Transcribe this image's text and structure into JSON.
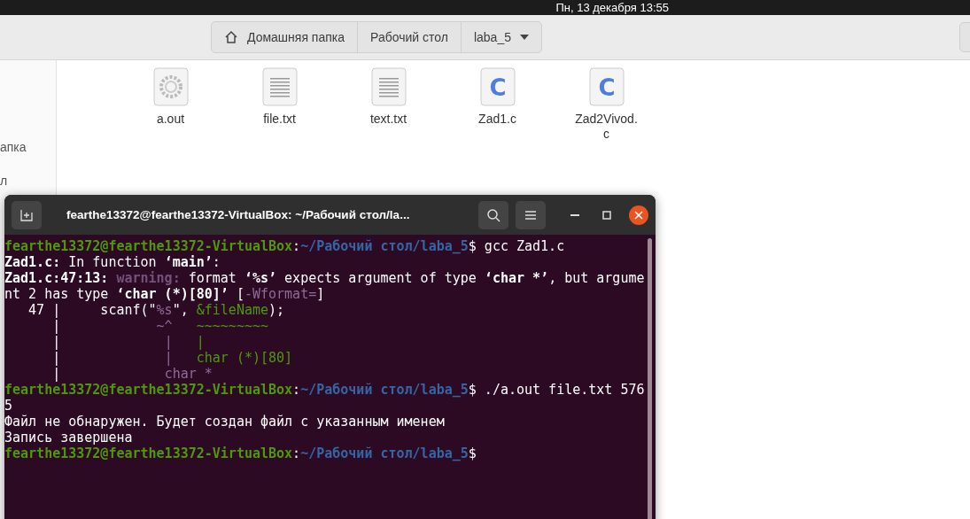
{
  "top_bar": {
    "clock": "Пн, 13 декабря  13:55"
  },
  "path_bar": {
    "items": [
      {
        "label": "Домашняя папка",
        "kind": "home"
      },
      {
        "label": "Рабочий стол",
        "kind": "plain"
      },
      {
        "label": "laba_5",
        "kind": "dropdown"
      }
    ]
  },
  "sidebar": {
    "items": [
      "апка",
      "л"
    ]
  },
  "files": [
    {
      "name": "a.out",
      "kind": "binary"
    },
    {
      "name": "file.txt",
      "kind": "text"
    },
    {
      "name": "text.txt",
      "kind": "text"
    },
    {
      "name": "Zad1.c",
      "kind": "c",
      "glyph": "C"
    },
    {
      "name": "Zad2Vivod.\nc",
      "kind": "c",
      "glyph": "C"
    }
  ],
  "terminal": {
    "title": "fearthe13372@fearthe13372-VirtualBox: ~/Рабочий стол/la...",
    "lines": [
      [
        {
          "text": "fearthe13372@fearthe13372-VirtualBox",
          "kind": "user"
        },
        {
          "text": ":",
          "kind": "plain"
        },
        {
          "text": "~/Рабочий стол/laba_5",
          "kind": "path"
        },
        {
          "text": "$ gcc Zad1.c",
          "kind": "plain"
        }
      ],
      [
        {
          "text": "Zad1.c:",
          "kind": "bold"
        },
        {
          "text": " In function ",
          "kind": "plain"
        },
        {
          "text": "‘main’",
          "kind": "bold"
        },
        {
          "text": ":",
          "kind": "plain"
        }
      ],
      [
        {
          "text": "Zad1.c:47:13:",
          "kind": "bold"
        },
        {
          "text": " warning:",
          "kind": "warn"
        },
        {
          "text": " format ",
          "kind": "plain"
        },
        {
          "text": "‘%s’",
          "kind": "bold"
        },
        {
          "text": " expects argument of type ",
          "kind": "plain"
        },
        {
          "text": "‘char *’",
          "kind": "bold"
        },
        {
          "text": ", but argume",
          "kind": "plain"
        }
      ],
      [
        {
          "text": "nt 2 has type ",
          "kind": "plain"
        },
        {
          "text": "‘char (*)[80]’",
          "kind": "bold"
        },
        {
          "text": " [",
          "kind": "plain"
        },
        {
          "text": "-Wformat=",
          "kind": "magenta"
        },
        {
          "text": "]",
          "kind": "plain"
        }
      ],
      [
        {
          "text": "   47 |     scanf(\"",
          "kind": "plain"
        },
        {
          "text": "%s",
          "kind": "magenta"
        },
        {
          "text": "\", ",
          "kind": "plain"
        },
        {
          "text": "&fileName",
          "kind": "green"
        },
        {
          "text": ");",
          "kind": "plain"
        }
      ],
      [
        {
          "text": "      |            ",
          "kind": "plain"
        },
        {
          "text": "~^",
          "kind": "magenta"
        },
        {
          "text": "   ~~~~~~~~~",
          "kind": "green"
        }
      ],
      [
        {
          "text": "      |             ",
          "kind": "plain"
        },
        {
          "text": "|",
          "kind": "magenta"
        },
        {
          "text": "   |",
          "kind": "green"
        }
      ],
      [
        {
          "text": "      |             ",
          "kind": "plain"
        },
        {
          "text": "|",
          "kind": "magenta"
        },
        {
          "text": "   char (*)[80]",
          "kind": "green"
        }
      ],
      [
        {
          "text": "      |             ",
          "kind": "plain"
        },
        {
          "text": "char *",
          "kind": "magenta"
        }
      ],
      [
        {
          "text": "fearthe13372@fearthe13372-VirtualBox",
          "kind": "user"
        },
        {
          "text": ":",
          "kind": "plain"
        },
        {
          "text": "~/Рабочий стол/laba_5",
          "kind": "path"
        },
        {
          "text": "$ ./a.out file.txt 576",
          "kind": "plain"
        }
      ],
      [
        {
          "text": "5",
          "kind": "plain"
        }
      ],
      [
        {
          "text": "Файл не обнаружен. Будет создан файл с указанным именем",
          "kind": "plain"
        }
      ],
      [
        {
          "text": "Запись завершена",
          "kind": "plain"
        }
      ],
      [
        {
          "text": "fearthe13372@fearthe13372-VirtualBox",
          "kind": "user"
        },
        {
          "text": ":",
          "kind": "plain"
        },
        {
          "text": "~/Рабочий стол/laba_5",
          "kind": "path"
        },
        {
          "text": "$",
          "kind": "plain"
        }
      ]
    ]
  }
}
